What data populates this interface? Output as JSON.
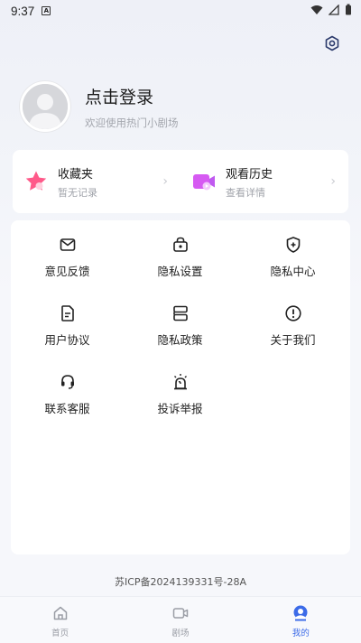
{
  "status_bar": {
    "time": "9:37",
    "notification_badge": "A"
  },
  "profile": {
    "title": "点击登录",
    "subtitle": "欢迎使用热门小剧场"
  },
  "quick_cards": [
    {
      "title": "收藏夹",
      "subtitle": "暂无记录",
      "icon": "star-icon",
      "color": "#ff5a8a"
    },
    {
      "title": "观看历史",
      "subtitle": "查看详情",
      "icon": "video-icon",
      "color": "#c05af0"
    }
  ],
  "grid_items": [
    {
      "label": "意见反馈",
      "icon": "mail-icon"
    },
    {
      "label": "隐私设置",
      "icon": "lock-icon"
    },
    {
      "label": "隐私中心",
      "icon": "shield-plus-icon"
    },
    {
      "label": "用户协议",
      "icon": "document-icon"
    },
    {
      "label": "隐私政策",
      "icon": "policy-icon"
    },
    {
      "label": "关于我们",
      "icon": "info-icon"
    },
    {
      "label": "联系客服",
      "icon": "headset-icon"
    },
    {
      "label": "投诉举报",
      "icon": "alarm-icon"
    }
  ],
  "icp": "苏ICP备2024139331号-28A",
  "tabs": [
    {
      "label": "首页",
      "icon": "home-icon",
      "active": false
    },
    {
      "label": "剧场",
      "icon": "theater-icon",
      "active": false
    },
    {
      "label": "我的",
      "icon": "profile-icon",
      "active": true
    }
  ],
  "colors": {
    "accent": "#3c6be8",
    "background": "#f6f7fb"
  }
}
